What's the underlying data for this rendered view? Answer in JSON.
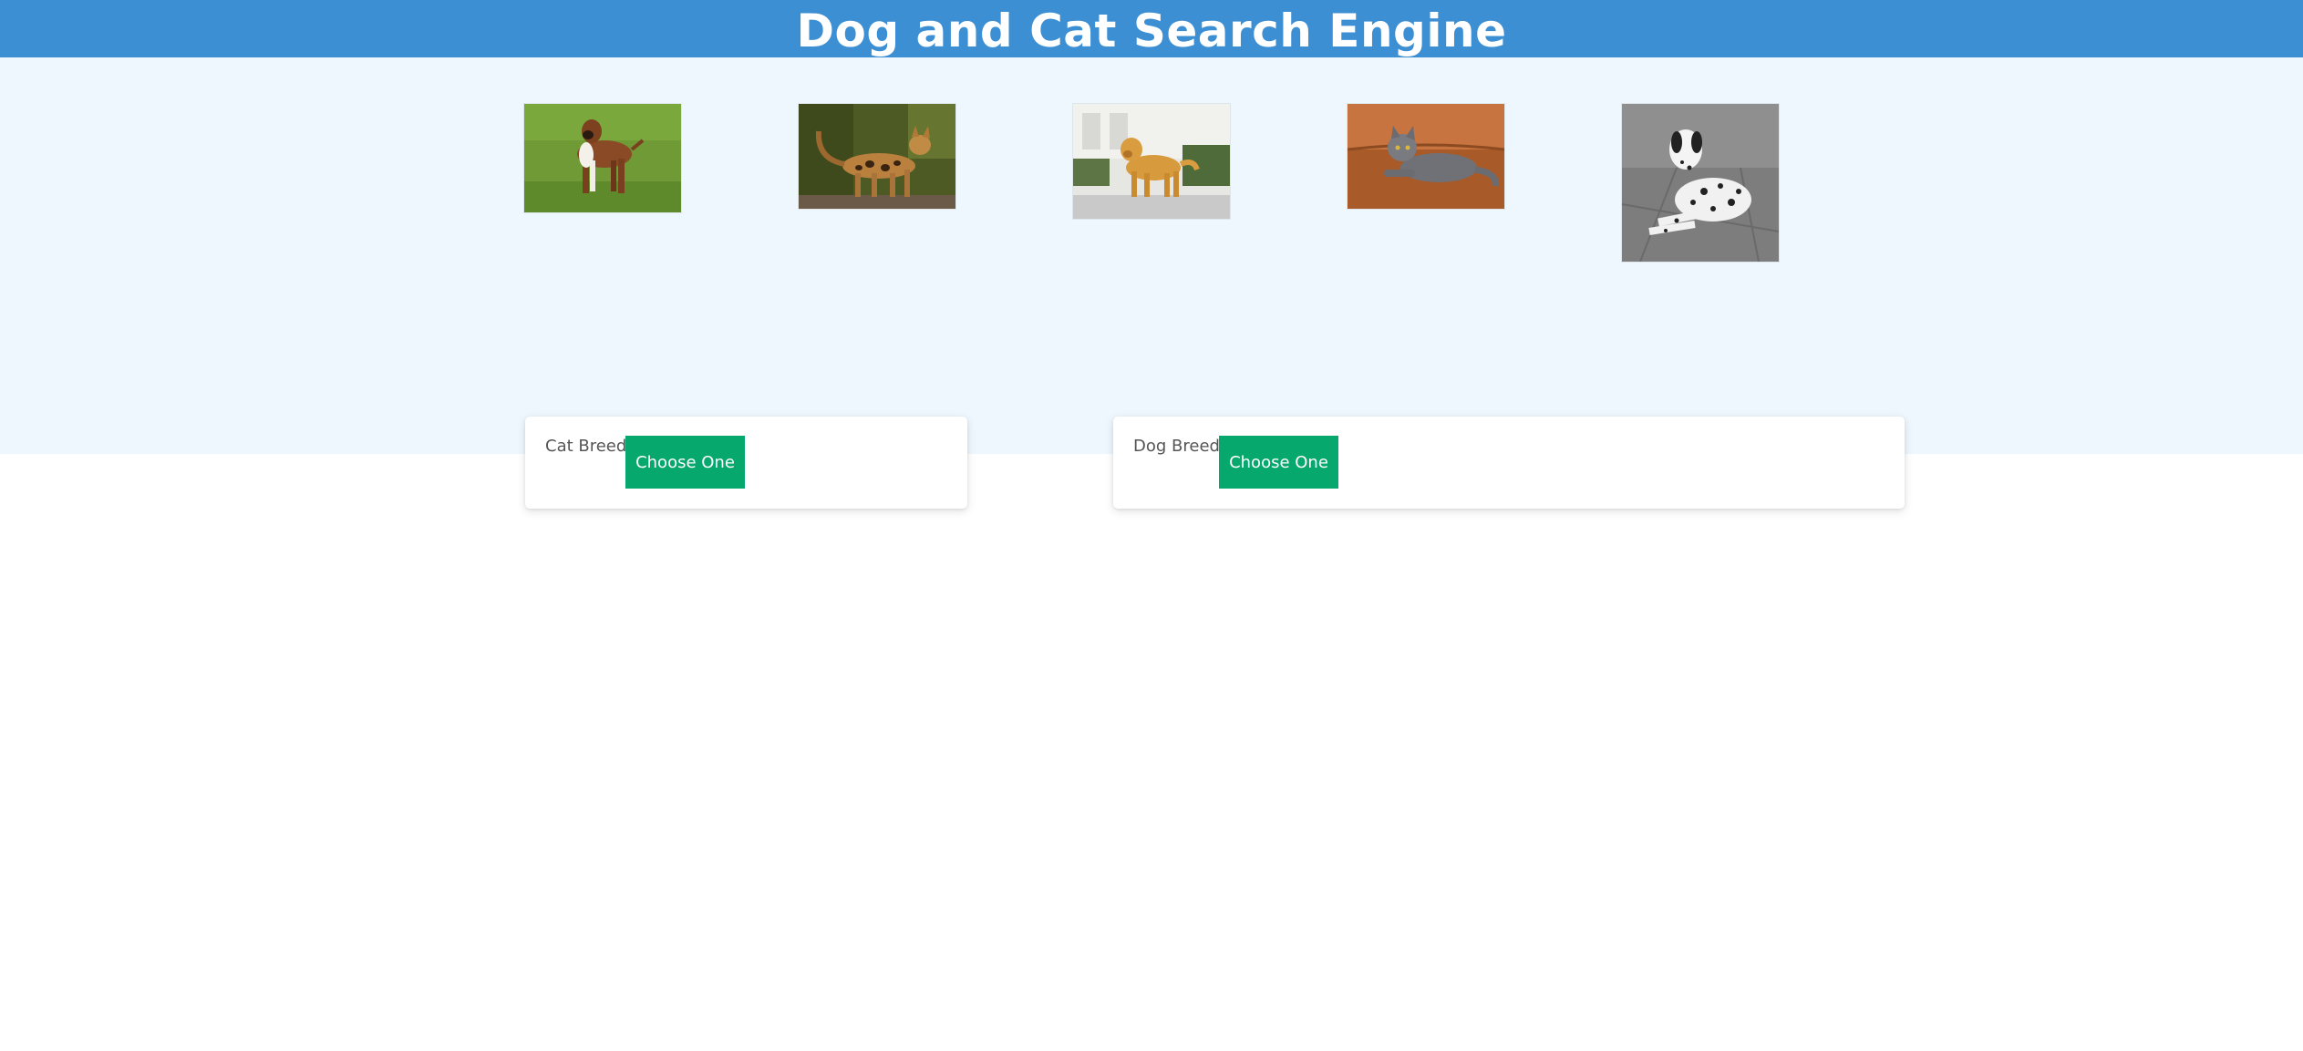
{
  "header": {
    "title": "Dog and Cat Search Engine"
  },
  "gallery": [
    {
      "name": "boxer-dog-image"
    },
    {
      "name": "bengal-cat-image"
    },
    {
      "name": "golden-retriever-image"
    },
    {
      "name": "gray-cat-image"
    },
    {
      "name": "dalmatian-image"
    }
  ],
  "cat_card": {
    "label": "Cat Breeds",
    "button_label": "Choose One"
  },
  "dog_card": {
    "label": "Dog Breeds",
    "button_label": "Choose One"
  },
  "colors": {
    "header_bg": "#3d8fd4",
    "hero_bg": "#eef7fd",
    "button_bg": "#06a86d"
  }
}
